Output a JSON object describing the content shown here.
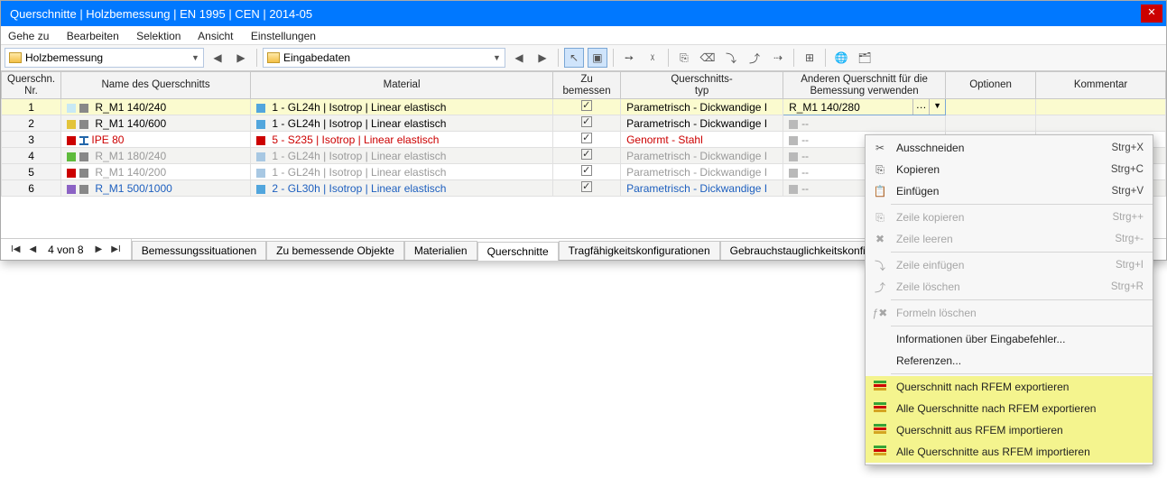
{
  "title": "Querschnitte | Holzbemessung | EN 1995 | CEN | 2014-05",
  "menu": {
    "goto": "Gehe zu",
    "edit": "Bearbeiten",
    "selection": "Selektion",
    "view": "Ansicht",
    "settings": "Einstellungen"
  },
  "toolbar": {
    "combo1": "Holzbemessung",
    "combo2": "Eingabedaten"
  },
  "headers": {
    "nr": "Querschn.\nNr.",
    "name": "Name des Querschnitts",
    "material": "Material",
    "tobem": "Zu\nbemessen",
    "qtyp": "Querschnitts-\ntyp",
    "other": "Anderen Querschnitt für die\nBemessung verwenden",
    "options": "Optionen",
    "comment": "Kommentar"
  },
  "rows": [
    {
      "nr": "1",
      "nameColor": "#c8e9f4",
      "name": "R_M1 140/240",
      "matColor": "#52a6dd",
      "material": "1 - GL24h | Isotrop | Linear elastisch",
      "typ": "Parametrisch - Dickwandige I",
      "other": "R_M1 140/280",
      "cls": "",
      "sel": true
    },
    {
      "nr": "2",
      "nameColor": "#e3c43a",
      "name": "R_M1 140/600",
      "matColor": "#52a6dd",
      "material": "1 - GL24h | Isotrop | Linear elastisch",
      "typ": "Parametrisch - Dickwandige I",
      "other": "--",
      "cls": ""
    },
    {
      "nr": "3",
      "nameColor": "ibeam",
      "name": "IPE 80",
      "matColor": "#cc0000",
      "material": "5 - S235 | Isotrop | Linear elastisch",
      "typ": "Genormt - Stahl",
      "other": "--",
      "cls": "red"
    },
    {
      "nr": "4",
      "nameColor": "#5fbb3c",
      "name": "R_M1 180/240",
      "matColor": "#a8c8e3",
      "material": "1 - GL24h | Isotrop | Linear elastisch",
      "typ": "Parametrisch - Dickwandige I",
      "other": "--",
      "cls": "gray"
    },
    {
      "nr": "5",
      "nameColor": "#cc0000",
      "name": "R_M1 140/200",
      "matColor": "#a8c8e3",
      "material": "1 - GL24h | Isotrop | Linear elastisch",
      "typ": "Parametrisch - Dickwandige I",
      "other": "--",
      "cls": "gray"
    },
    {
      "nr": "6",
      "nameColor": "#8c63c4",
      "name": "R_M1 500/1000",
      "matColor": "#52a6dd",
      "material": "2 - GL30h | Isotrop | Linear elastisch",
      "typ": "Parametrisch - Dickwandige I",
      "other": "--",
      "cls": "blue"
    }
  ],
  "footer": {
    "navtext": "4 von 8",
    "tabs": [
      "Bemessungssituationen",
      "Zu bemessende Objekte",
      "Materialien",
      "Querschnitte",
      "Tragfähigkeitskonfigurationen",
      "Gebrauchstauglichkeitskonfigurationen"
    ]
  },
  "ctx": {
    "cut": {
      "lbl": "Ausschneiden",
      "k": "Strg+X"
    },
    "copy": {
      "lbl": "Kopieren",
      "k": "Strg+C"
    },
    "paste": {
      "lbl": "Einfügen",
      "k": "Strg+V"
    },
    "rowcopy": {
      "lbl": "Zeile kopieren",
      "k": "Strg++"
    },
    "rowclear": {
      "lbl": "Zeile leeren",
      "k": "Strg+-"
    },
    "rowins": {
      "lbl": "Zeile einfügen",
      "k": "Strg+I"
    },
    "rowdel": {
      "lbl": "Zeile löschen",
      "k": "Strg+R"
    },
    "formdel": {
      "lbl": "Formeln löschen"
    },
    "info": {
      "lbl": "Informationen über Eingabefehler..."
    },
    "refs": {
      "lbl": "Referenzen..."
    },
    "exp1": {
      "lbl": "Querschnitt nach RFEM exportieren"
    },
    "exp2": {
      "lbl": "Alle Querschnitte nach RFEM exportieren"
    },
    "imp1": {
      "lbl": "Querschnitt aus RFEM importieren"
    },
    "imp2": {
      "lbl": "Alle Querschnitte aus RFEM importieren"
    }
  }
}
